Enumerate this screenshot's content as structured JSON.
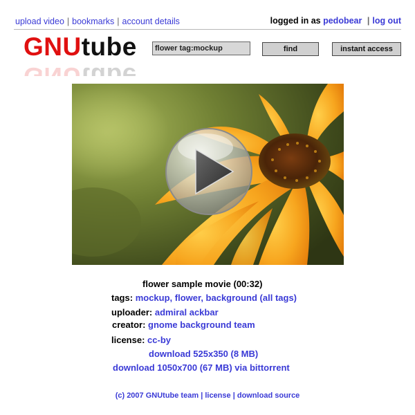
{
  "topnav": {
    "upload": "upload video",
    "bookmarks": "bookmarks",
    "account": "account details",
    "separator": "|",
    "logged_in_prefix": "logged in as",
    "username": "pedobear",
    "logout": "log out"
  },
  "logo": {
    "gnu": "GNU",
    "tube": "tube"
  },
  "search": {
    "value": "flower tag:mockup",
    "find_label": "find",
    "instant_label": "instant access"
  },
  "video": {
    "title": "flower sample movie (00:32)",
    "tags_label": "tags:",
    "tags_value": "mockup, flower, background (all tags)",
    "uploader_label": "uploader:",
    "uploader_value": "admiral ackbar",
    "creator_label": "creator:",
    "creator_value": "gnome background team",
    "license_label": "license:",
    "license_value": "cc-by",
    "download_small": "download 525x350 (8 MB)",
    "download_large": "download 1050x700 (67 MB) via bittorrent"
  },
  "footer": {
    "copyright": "(c) 2007 GNUtube team",
    "license": "license",
    "download_source": "download source",
    "separator": "|"
  },
  "colors": {
    "link": "#3a3ad6",
    "logo_red": "#e01010",
    "petal_orange": "#f5a21a"
  }
}
